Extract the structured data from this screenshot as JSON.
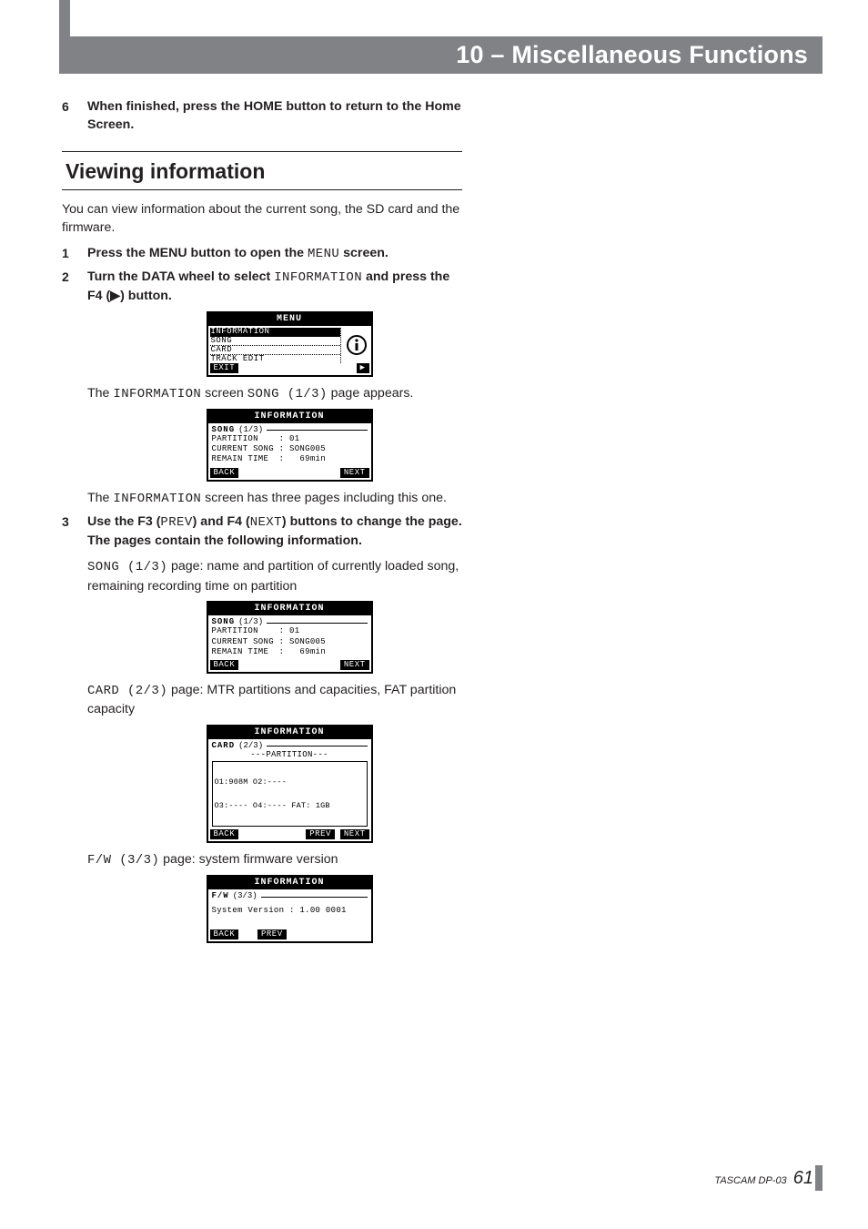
{
  "header": {
    "chapter_title": "10 – Miscellaneous Functions"
  },
  "top_step": {
    "num": "6",
    "text": "When finished, press the HOME button to return to the Home Screen."
  },
  "section": {
    "title": "Viewing information",
    "intro": "You can view information about the current song, the SD card and the firmware."
  },
  "steps": [
    {
      "num": "1",
      "bold_pre": "Press the MENU button to open the ",
      "lcd_word": "MENU",
      "bold_post": " screen."
    },
    {
      "num": "2",
      "bold_pre": "Turn the DATA wheel to select ",
      "lcd_word": "INFORMATION",
      "bold_post": " and press the F4 (▶) button."
    }
  ],
  "after_fig1": {
    "l1_pre": "The ",
    "l1_lcd1": "INFORMATION",
    "l1_mid": " screen ",
    "l1_lcd2": "SONG (1/3)",
    "l1_post": " page appears."
  },
  "after_fig2": {
    "l1_pre": "The ",
    "l1_lcd": "INFORMATION",
    "l1_post": " screen has three pages including this one."
  },
  "step3": {
    "num": "3",
    "bold_pre": "Use the F3 (",
    "lcd1": "PREV",
    "bold_mid1": ") and F4 (",
    "lcd2": "NEXT",
    "bold_mid2": ") buttons to change the page. The pages contain the following information."
  },
  "page_descs": {
    "song": {
      "lcd": "SONG (1/3)",
      "text": " page: name and partition of currently loaded song, remaining recording time on partition"
    },
    "card": {
      "lcd": "CARD (2/3)",
      "text": " page: MTR partitions and capacities, FAT partition capacity"
    },
    "fw": {
      "lcd": "F/W (3/3)",
      "text": " page: system firmware version"
    }
  },
  "figs": {
    "menu": {
      "title": "MENU",
      "items": [
        "INFORMATION",
        "SONG",
        "CARD",
        "TRACK EDIT"
      ],
      "selected": 0,
      "footer_left": "EXIT",
      "footer_right": "▶"
    },
    "info_song_a": {
      "title": "INFORMATION",
      "tab": "SONG",
      "page": "(1/3)",
      "rows": [
        "PARTITION    : 01",
        "CURRENT SONG : SONG005",
        "REMAIN TIME  :   69min"
      ],
      "footer_left": "BACK",
      "footer_right": "NEXT"
    },
    "info_song_b": {
      "title": "INFORMATION",
      "tab": "SONG",
      "page": "(1/3)",
      "rows": [
        "PARTITION    : 01",
        "CURRENT SONG : SONG005",
        "REMAIN TIME  :   69min"
      ],
      "footer_left": "BACK",
      "footer_right": "NEXT"
    },
    "info_card": {
      "title": "INFORMATION",
      "tab": "CARD",
      "page": "(2/3)",
      "partition_head": "---PARTITION---",
      "partition_rows": [
        "O1:908M O2:----",
        "O3:---- O4:---- FAT: 1GB"
      ],
      "footer_left": "BACK",
      "footer_mid": "PREV",
      "footer_right": "NEXT"
    },
    "info_fw": {
      "title": "INFORMATION",
      "tab": "F/W",
      "page": "(3/3)",
      "rows": [
        "System Version : 1.00 0001"
      ],
      "footer_left": "BACK",
      "footer_mid": "PREV"
    }
  },
  "footer": {
    "brand": "TASCAM DP-03",
    "page": "61"
  }
}
